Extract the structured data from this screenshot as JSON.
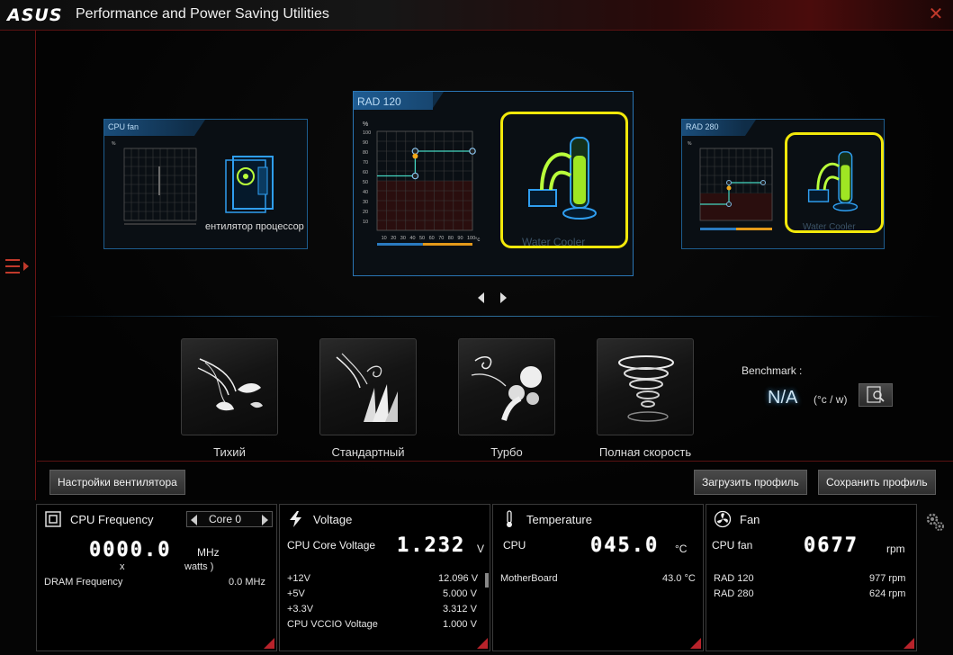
{
  "app": {
    "logo": "ASUS",
    "title": "Performance and Power Saving Utilities"
  },
  "fans": {
    "left": {
      "title": "CPU fan",
      "caption": "ентилятор процессор"
    },
    "center": {
      "title": "RAD 120",
      "caption": "Water Cooler",
      "y_unit": "%",
      "x_unit": "°c",
      "y_ticks": [
        "100",
        "90",
        "80",
        "70",
        "60",
        "50",
        "40",
        "30",
        "20",
        "10"
      ],
      "x_ticks": [
        "10",
        "20",
        "30",
        "40",
        "50",
        "60",
        "70",
        "80",
        "90",
        "100"
      ],
      "curve_points": [
        [
          0,
          55
        ],
        [
          40,
          55
        ],
        [
          40,
          80
        ],
        [
          100,
          80
        ]
      ]
    },
    "right": {
      "title": "RAD 280",
      "caption": "Water Cooler"
    }
  },
  "modes": [
    {
      "label": "Тихий",
      "icon": "leaves-wind-icon"
    },
    {
      "label": "Стандартный",
      "icon": "grass-wind-icon"
    },
    {
      "label": "Турбо",
      "icon": "wind-gust-icon"
    },
    {
      "label": "Полная скорость",
      "icon": "tornado-icon"
    }
  ],
  "benchmark": {
    "label": "Benchmark :",
    "value": "N/A",
    "unit": "(°c / w)",
    "icon": "benchmark-search-icon"
  },
  "buttons": {
    "fan_settings": "Настройки вентилятора",
    "load_profile": "Загрузить профиль",
    "save_profile": "Сохранить профиль"
  },
  "cpu": {
    "title": "CPU Frequency",
    "core": "Core 0",
    "value": "0000.0",
    "unit": "MHz",
    "line2a": "x",
    "line2b": "watts )",
    "dram_label": "DRAM Frequency",
    "dram_value": "0.0  MHz"
  },
  "voltage": {
    "title": "Voltage",
    "main_label": "CPU Core Voltage",
    "main_value": "1.232",
    "main_unit": "V",
    "rows": [
      {
        "label": "+12V",
        "value": "12.096  V"
      },
      {
        "label": "+5V",
        "value": "5.000  V"
      },
      {
        "label": "+3.3V",
        "value": "3.312  V"
      },
      {
        "label": "CPU VCCIO Voltage",
        "value": "1.000  V"
      }
    ]
  },
  "temperature": {
    "title": "Temperature",
    "main_label": "CPU",
    "main_value": "045.0",
    "main_unit": "°C",
    "rows": [
      {
        "label": "MotherBoard",
        "value": "43.0 °C"
      }
    ]
  },
  "fan": {
    "title": "Fan",
    "main_label": "CPU fan",
    "main_value": "0677",
    "main_unit": "rpm",
    "rows": [
      {
        "label": "RAD 120",
        "value": "977  rpm"
      },
      {
        "label": "RAD 280",
        "value": "624  rpm"
      }
    ]
  },
  "colors": {
    "accent_red": "#b8232b",
    "accent_blue": "#1d5d8f",
    "highlight_yellow": "#f2e80a"
  }
}
